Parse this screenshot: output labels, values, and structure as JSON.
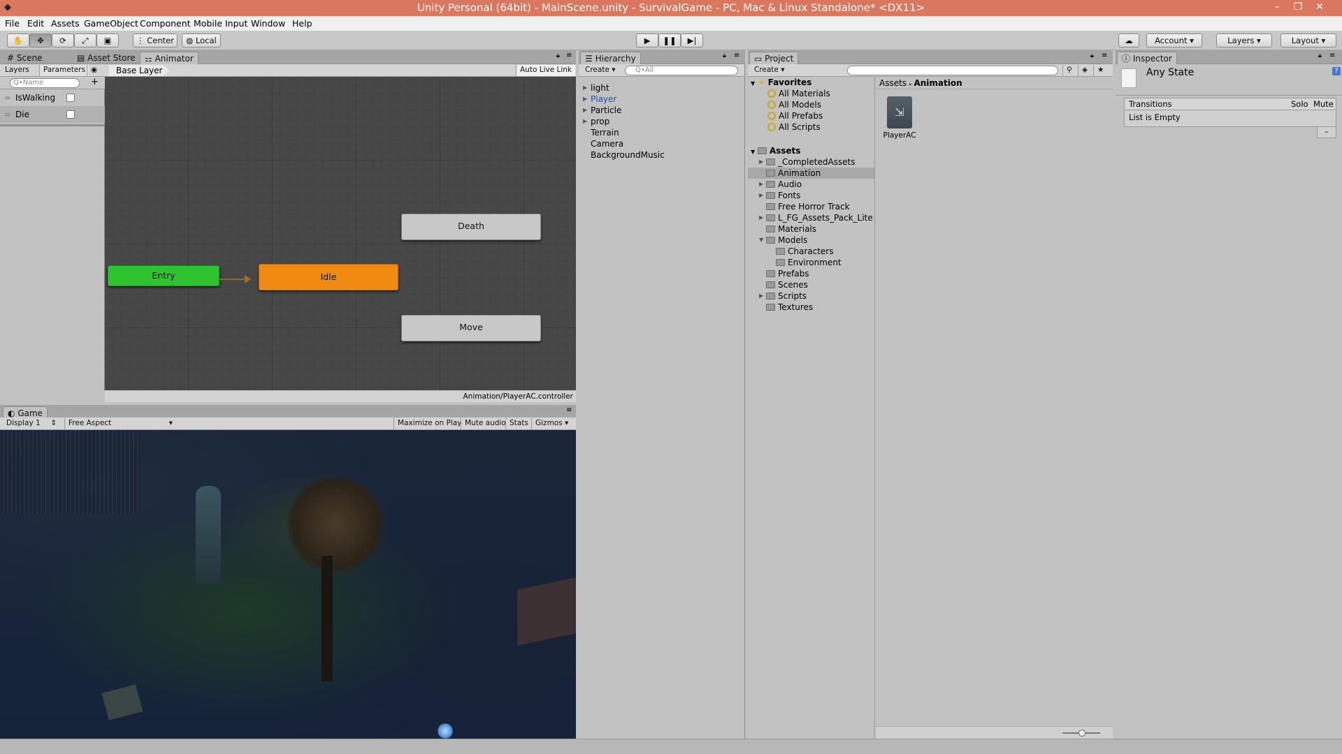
{
  "window": {
    "title": "Unity Personal (64bit) - MainScene.unity - SurvivalGame - PC, Mac & Linux Standalone* <DX11>"
  },
  "menu": [
    "File",
    "Edit",
    "Assets",
    "GameObject",
    "Component",
    "Mobile Input",
    "Window",
    "Help"
  ],
  "toolbar": {
    "pivot_label": "Center",
    "space_label": "Local",
    "account_label": "Account",
    "layers_label": "Layers",
    "layout_label": "Layout"
  },
  "animator": {
    "tabs": {
      "scene": "Scene",
      "asset_store": "Asset Store",
      "animator": "Animator"
    },
    "left_tabs": {
      "layers": "Layers",
      "parameters": "Parameters"
    },
    "search_placeholder": "Q•Name",
    "add_label": "+",
    "breadcrumb": "Base Layer",
    "auto_live_link": "Auto Live Link",
    "parameters": [
      {
        "name": "IsWalking",
        "value": false
      },
      {
        "name": "Die",
        "value": false
      }
    ],
    "states": {
      "entry": "Entry",
      "idle": "Idle",
      "death": "Death",
      "move": "Move"
    },
    "controller_path": "Animation/PlayerAC.controller",
    "colors": {
      "entry": "#2fc42f",
      "default_state": "#f08a10",
      "state": "#c8c8c8"
    }
  },
  "game": {
    "tab": "Game",
    "display": "Display 1",
    "aspect": "Free Aspect",
    "buttons": {
      "maximize": "Maximize on Play",
      "mute": "Mute audio",
      "stats": "Stats",
      "gizmos": "Gizmos"
    }
  },
  "hierarchy": {
    "tab": "Hierarchy",
    "create_label": "Create",
    "search_placeholder": "Q•All",
    "items": [
      {
        "label": "light",
        "expandable": true,
        "selected": false
      },
      {
        "label": "Player",
        "expandable": true,
        "selected": true
      },
      {
        "label": "Particle",
        "expandable": true,
        "selected": false
      },
      {
        "label": "prop",
        "expandable": true,
        "selected": false
      },
      {
        "label": "Terrain",
        "expandable": false,
        "selected": false
      },
      {
        "label": "Camera",
        "expandable": false,
        "selected": false
      },
      {
        "label": "BackgroundMusic",
        "expandable": false,
        "selected": false
      }
    ]
  },
  "project": {
    "tab": "Project",
    "create_label": "Create",
    "favorites_label": "Favorites",
    "favorites": [
      "All Materials",
      "All Models",
      "All Prefabs",
      "All Scripts"
    ],
    "assets_label": "Assets",
    "folders": [
      {
        "label": "_CompletedAssets",
        "depth": 1,
        "arrow": "right",
        "selected": false
      },
      {
        "label": "Animation",
        "depth": 1,
        "arrow": "none",
        "selected": true
      },
      {
        "label": "Audio",
        "depth": 1,
        "arrow": "right",
        "selected": false
      },
      {
        "label": "Fonts",
        "depth": 1,
        "arrow": "right",
        "selected": false
      },
      {
        "label": "Free Horror Track",
        "depth": 1,
        "arrow": "none",
        "selected": false
      },
      {
        "label": "L_FG_Assets_Pack_Lite",
        "depth": 1,
        "arrow": "right",
        "selected": false
      },
      {
        "label": "Materials",
        "depth": 1,
        "arrow": "none",
        "selected": false
      },
      {
        "label": "Models",
        "depth": 1,
        "arrow": "down",
        "selected": false
      },
      {
        "label": "Characters",
        "depth": 2,
        "arrow": "none",
        "selected": false
      },
      {
        "label": "Environment",
        "depth": 2,
        "arrow": "none",
        "selected": false
      },
      {
        "label": "Prefabs",
        "depth": 1,
        "arrow": "none",
        "selected": false
      },
      {
        "label": "Scenes",
        "depth": 1,
        "arrow": "none",
        "selected": false
      },
      {
        "label": "Scripts",
        "depth": 1,
        "arrow": "right",
        "selected": false
      },
      {
        "label": "Textures",
        "depth": 1,
        "arrow": "none",
        "selected": false
      }
    ],
    "breadcrumb": {
      "root": "Assets",
      "current": "Animation"
    },
    "grid_item": "PlayerAC"
  },
  "inspector": {
    "tab": "Inspector",
    "title": "Any State",
    "transitions_label": "Transitions",
    "solo_label": "Solo",
    "mute_label": "Mute",
    "empty_label": "List is Empty",
    "remove_label": "–"
  }
}
